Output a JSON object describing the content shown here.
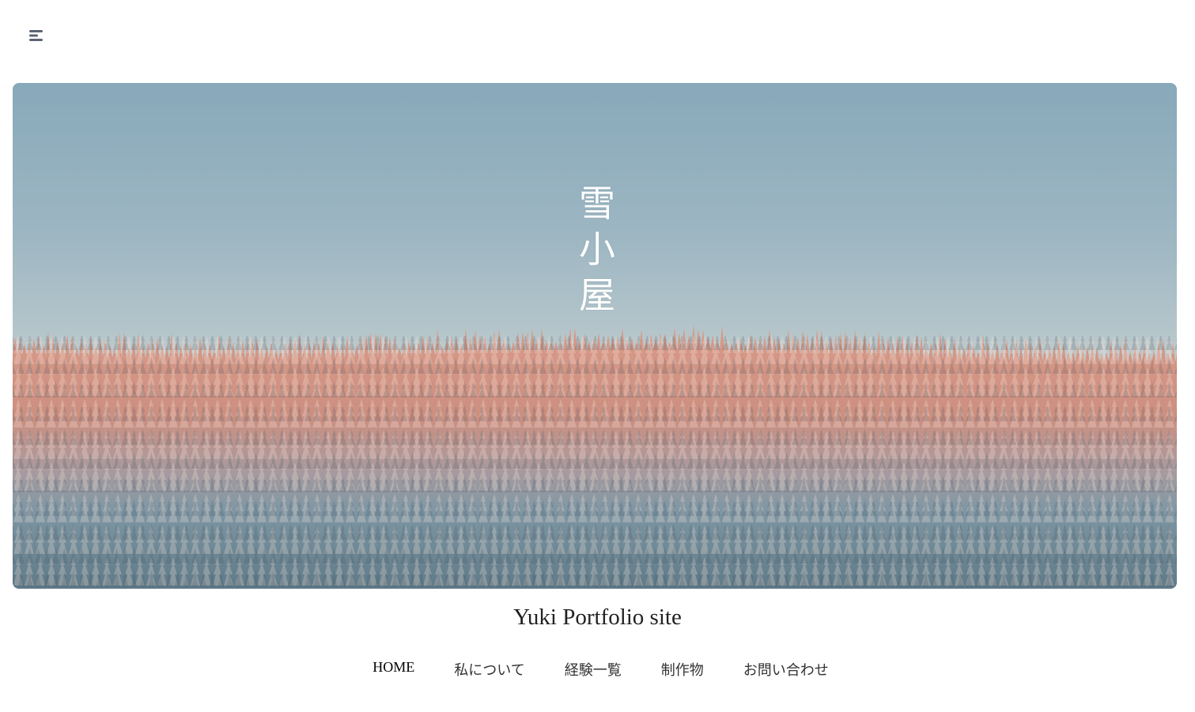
{
  "header": {
    "menu_icon": "menu-icon"
  },
  "hero": {
    "title": "雪小屋"
  },
  "site": {
    "name": "Yuki Portfolio site"
  },
  "nav": {
    "items": [
      {
        "label": "HOME"
      },
      {
        "label": "私について"
      },
      {
        "label": "経験一覧"
      },
      {
        "label": "制作物"
      },
      {
        "label": "お問い合わせ"
      }
    ]
  },
  "colors": {
    "sky": "#9db6c2",
    "forest_lit": "#d9998a",
    "forest_shade": "#6f8794",
    "text": "#222222",
    "icon": "#5b6375"
  }
}
